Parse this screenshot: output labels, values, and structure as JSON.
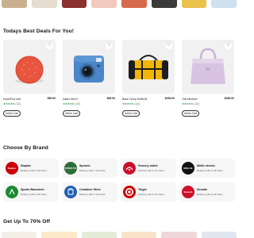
{
  "top_strip_colors": [
    "#c9b08f",
    "#e6dcd0",
    "#8c2f2f",
    "#f2c9bd",
    "#d66a4a",
    "#3b3b3b",
    "#e9c24a",
    "#cfe0ef"
  ],
  "deals": {
    "title": "Todays Best Deals For You!",
    "products": [
      {
        "name": "HomePod mini",
        "price": "$99.00",
        "stars": "★★★★★",
        "reviews": "(121)",
        "button": "Add to Cart",
        "image": "smart-speaker"
      },
      {
        "name": "Instax Mini 9",
        "price": "$99.00",
        "stars": "★★★★★",
        "reviews": "(121)",
        "button": "Add to Cart",
        "image": "instant-camera"
      },
      {
        "name": "Base Camp Duffel M",
        "price": "$159.00",
        "stars": "★★★★★",
        "reviews": "(121)",
        "button": "Add to Cart",
        "image": "duffel-bag"
      },
      {
        "name": "Tote Medium",
        "price": "$259.00",
        "stars": "★★★★★",
        "reviews": "(121)",
        "button": "Add to Cart",
        "image": "tote-bag"
      }
    ]
  },
  "brands": {
    "title": "Choose By Brand",
    "items": [
      {
        "name": "Staples",
        "sub": "Delivery with in 24 hours",
        "logo_text": "Staples",
        "color": "#cc0000"
      },
      {
        "name": "Sprouts",
        "sub": "Delivery with in 24 hours",
        "logo_text": "SPROUTS",
        "color": "#2e6e3a"
      },
      {
        "name": "Grocery outlet",
        "sub": "Delivery with in 24 hours",
        "logo_text": "",
        "color": "#c8102e"
      },
      {
        "name": "Mollie stones",
        "sub": "Delivery with in 24 hours",
        "logo_text": "MOLLIE",
        "color": "#111111"
      },
      {
        "name": "Sports Basement",
        "sub": "Delivery with in 24 hours",
        "logo_text": "",
        "color": "#1a8a2e"
      },
      {
        "name": "Container Store",
        "sub": "Delivery with in 24 hours",
        "logo_text": "",
        "color": "#1f5fb5"
      },
      {
        "name": "Target",
        "sub": "Delivery with in 24 hours",
        "logo_text": "",
        "color": "#cc0000"
      },
      {
        "name": "Sounds",
        "sub": "Delivery with in 24 hours",
        "logo_text": "Sounds",
        "color": "#d0102a"
      }
    ]
  },
  "promo": {
    "title": "Get Up To 70% Off"
  },
  "bottom_strip_colors": [
    "#f3efe6",
    "#fde9c9",
    "#e4ecd7",
    "#f8e3c8",
    "#f0d7da",
    "#dfe6f0"
  ]
}
